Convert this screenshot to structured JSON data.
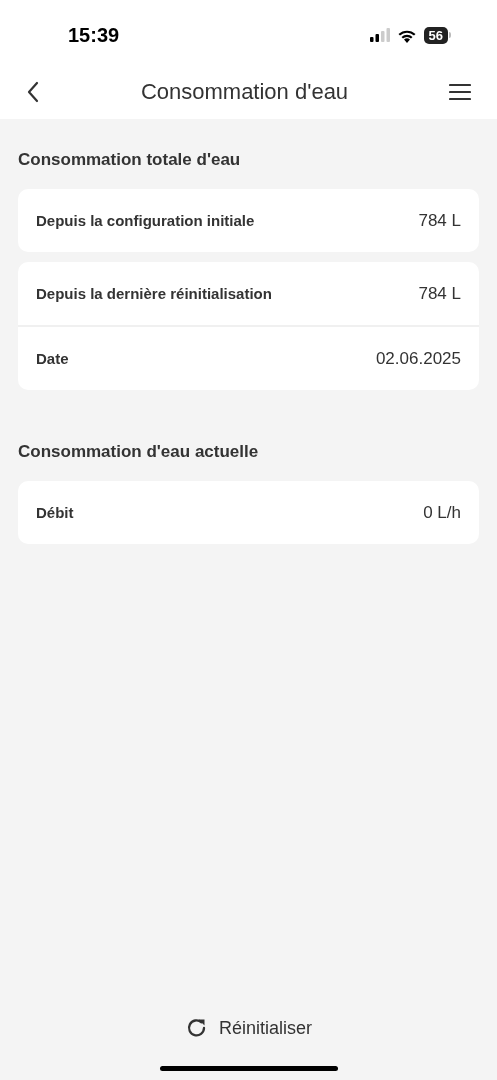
{
  "status_bar": {
    "time": "15:39",
    "battery": "56"
  },
  "header": {
    "title": "Consommation d'eau"
  },
  "sections": [
    {
      "title": "Consommation totale d'eau",
      "cards": [
        [
          {
            "label": "Depuis la configuration initiale",
            "value": "784 L"
          }
        ],
        [
          {
            "label": "Depuis la dernière réinitialisation",
            "value": "784 L"
          },
          {
            "label": "Date",
            "value": "02.06.2025"
          }
        ]
      ]
    },
    {
      "title": "Consommation d'eau actuelle",
      "cards": [
        [
          {
            "label": "Débit",
            "value": "0 L/h"
          }
        ]
      ]
    }
  ],
  "reset_button": {
    "label": "Réinitialiser"
  }
}
